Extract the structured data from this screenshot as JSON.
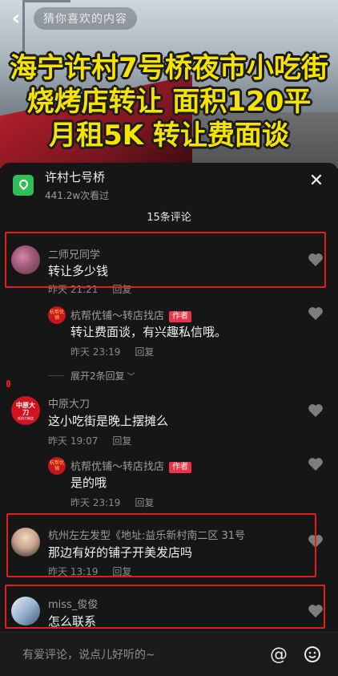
{
  "video": {
    "top_title": "猜你喜欢的内容",
    "headline": [
      "海宁许村7号桥夜市小吃街",
      "烧烤店转让 面积120平",
      "月租5K 转让费面谈"
    ]
  },
  "place": {
    "name": "许村七号桥",
    "views": "441.2w次看过"
  },
  "comment_count": "15条评论",
  "comments": [
    {
      "name": "二师兄同学",
      "text": "转让多少钱",
      "time": "昨天 21:21",
      "reply": "回复"
    },
    {
      "name": "杭帮优铺～转店找店",
      "tag": "作者",
      "text": "转让费面谈，有兴趣私信哦。",
      "time": "昨天 23:19",
      "reply": "回复"
    },
    {
      "name": "中原大刀",
      "text": "这小吃街是晚上摆摊么",
      "time": "昨天 19:07",
      "reply": "回复"
    },
    {
      "name": "杭帮优铺～转店找店",
      "tag": "作者",
      "text": "是的哦",
      "time": "昨天 23:19",
      "reply": "回复"
    },
    {
      "name": "杭州左左发型《地址:益乐新村南二区 31号",
      "text": "那边有好的铺子开美发店吗",
      "time": "昨天 13:19",
      "reply": "回复"
    },
    {
      "name": "miss_俊俊",
      "text": "怎么联系"
    }
  ],
  "expand_replies": "展开2条回复",
  "avatar_text": {
    "zhongyuan": "中原大刀",
    "zhongyuan_sub": "抵抗力制造",
    "author": "杭帮优铺"
  },
  "input": {
    "placeholder": "有爱评论，说点儿好听的~"
  },
  "colors": {
    "accent_red": "#e41c1c",
    "author_tag": "#e8334a",
    "location_green": "#2fbf56",
    "headline_yellow": "#f5e400"
  }
}
